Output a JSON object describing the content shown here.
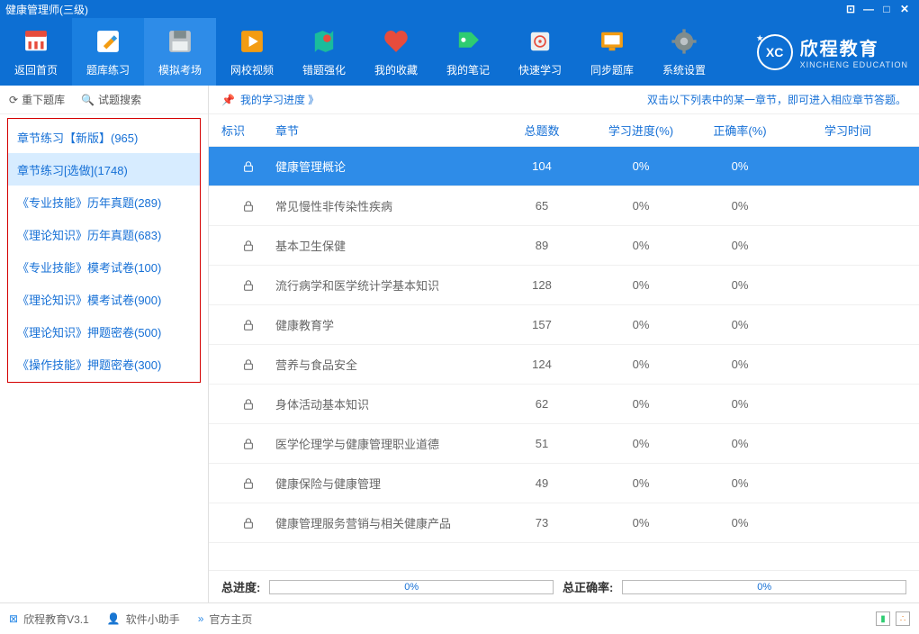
{
  "window": {
    "title": "健康管理师(三级)"
  },
  "toolbar": {
    "items": [
      {
        "label": "返回首页",
        "icon": "home"
      },
      {
        "label": "题库练习",
        "icon": "pencil"
      },
      {
        "label": "模拟考场",
        "icon": "save"
      },
      {
        "label": "网校视频",
        "icon": "play"
      },
      {
        "label": "错题强化",
        "icon": "map"
      },
      {
        "label": "我的收藏",
        "icon": "heart"
      },
      {
        "label": "我的笔记",
        "icon": "tag"
      },
      {
        "label": "快速学习",
        "icon": "safe"
      },
      {
        "label": "同步题库",
        "icon": "screen"
      },
      {
        "label": "系统设置",
        "icon": "gear"
      }
    ],
    "logo": {
      "abbr": "XC",
      "name": "欣程教育",
      "sub": "XINCHENG EDUCATION"
    }
  },
  "sidebar": {
    "reload": "重下题库",
    "search": "试题搜索",
    "items": [
      "章节练习【新版】(965)",
      "章节练习[选做](1748)",
      "《专业技能》历年真题(289)",
      "《理论知识》历年真题(683)",
      "《专业技能》模考试卷(100)",
      "《理论知识》模考试卷(900)",
      "《理论知识》押题密卷(500)",
      "《操作技能》押题密卷(300)"
    ]
  },
  "infobar": {
    "left": "我的学习进度 》",
    "right": "双击以下列表中的某一章节，即可进入相应章节答题。"
  },
  "columns": {
    "mark": "标识",
    "chap": "章节",
    "num": "总题数",
    "prog": "学习进度(%)",
    "acc": "正确率(%)",
    "time": "学习时间"
  },
  "rows": [
    {
      "chap": "健康管理概论",
      "num": "104",
      "prog": "0%",
      "acc": "0%",
      "hl": true
    },
    {
      "chap": "常见慢性非传染性疾病",
      "num": "65",
      "prog": "0%",
      "acc": "0%"
    },
    {
      "chap": "基本卫生保健",
      "num": "89",
      "prog": "0%",
      "acc": "0%"
    },
    {
      "chap": "流行病学和医学统计学基本知识",
      "num": "128",
      "prog": "0%",
      "acc": "0%"
    },
    {
      "chap": "健康教育学",
      "num": "157",
      "prog": "0%",
      "acc": "0%"
    },
    {
      "chap": "营养与食品安全",
      "num": "124",
      "prog": "0%",
      "acc": "0%"
    },
    {
      "chap": "身体活动基本知识",
      "num": "62",
      "prog": "0%",
      "acc": "0%"
    },
    {
      "chap": "医学伦理学与健康管理职业道德",
      "num": "51",
      "prog": "0%",
      "acc": "0%"
    },
    {
      "chap": "健康保险与健康管理",
      "num": "49",
      "prog": "0%",
      "acc": "0%"
    },
    {
      "chap": "健康管理服务营销与相关健康产品",
      "num": "73",
      "prog": "0%",
      "acc": "0%"
    }
  ],
  "progress": {
    "total_label": "总进度:",
    "total_val": "0%",
    "acc_label": "总正确率:",
    "acc_val": "0%"
  },
  "status": {
    "app": "欣程教育V3.1",
    "helper": "软件小助手",
    "home": "官方主页"
  }
}
